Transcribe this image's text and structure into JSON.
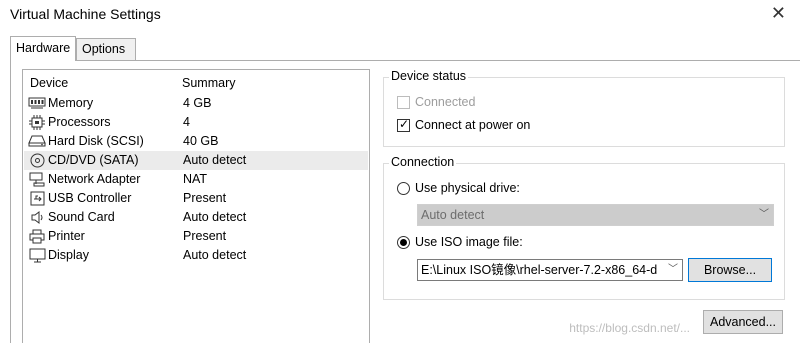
{
  "window": {
    "title": "Virtual Machine Settings",
    "close_glyph": "✕"
  },
  "tabs": [
    {
      "label": "Hardware",
      "active": true
    },
    {
      "label": "Options",
      "active": false
    }
  ],
  "device_list": {
    "headers": {
      "device": "Device",
      "summary": "Summary"
    },
    "rows": [
      {
        "name": "Memory",
        "summary": "4 GB",
        "icon": "memory-icon",
        "selected": false
      },
      {
        "name": "Processors",
        "summary": "4",
        "icon": "processor-icon",
        "selected": false
      },
      {
        "name": "Hard Disk (SCSI)",
        "summary": "40 GB",
        "icon": "hard-disk-icon",
        "selected": false
      },
      {
        "name": "CD/DVD (SATA)",
        "summary": "Auto detect",
        "icon": "cd-dvd-icon",
        "selected": true
      },
      {
        "name": "Network Adapter",
        "summary": "NAT",
        "icon": "network-adapter-icon",
        "selected": false
      },
      {
        "name": "USB Controller",
        "summary": "Present",
        "icon": "usb-icon",
        "selected": false
      },
      {
        "name": "Sound Card",
        "summary": "Auto detect",
        "icon": "speaker-icon",
        "selected": false
      },
      {
        "name": "Printer",
        "summary": "Present",
        "icon": "printer-icon",
        "selected": false
      },
      {
        "name": "Display",
        "summary": "Auto detect",
        "icon": "display-icon",
        "selected": false
      }
    ]
  },
  "device_status": {
    "legend": "Device status",
    "connected": {
      "label": "Connected",
      "checked": false,
      "disabled": true
    },
    "connect_at_power_on": {
      "label": "Connect at power on",
      "checked": true,
      "disabled": false
    }
  },
  "connection": {
    "legend": "Connection",
    "physical": {
      "label": "Use physical drive:",
      "selected": false,
      "value": "Auto detect"
    },
    "iso": {
      "label": "Use ISO image file:",
      "selected": true,
      "value": "E:\\Linux ISO镜像\\rhel-server-7.2-x86_64-d"
    },
    "browse_label": "Browse..."
  },
  "advanced_label": "Advanced...",
  "watermark": "https://blog.csdn.net/..."
}
